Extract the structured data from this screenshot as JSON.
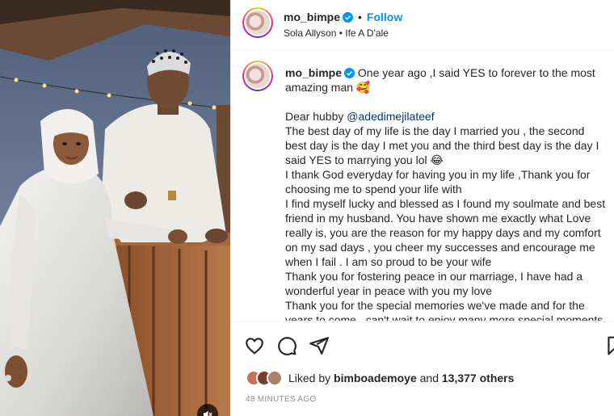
{
  "post": {
    "author": "mo_bimpe",
    "follow_label": "Follow",
    "separator": "•",
    "audio_line": "Sola Allyson • Ife A D'ale"
  },
  "caption": {
    "author": "mo_bimpe",
    "first_line": "One year ago ,I said YES to forever to the most amazing man 🥰",
    "greeting_prefix": "Dear hubby ",
    "mention": "@adedimejilateef",
    "lines": [
      "The best day of my life is the day I married you , the second best day is the day I met you and the third best day is the day I said YES to marrying you lol 😂",
      "I thank God everyday for having you in my life ,Thank you for choosing me to spend your life with",
      "I find myself lucky and blessed as I found my soulmate and best friend in my husband. You have shown me exactly what Love really is, you are the reason for my happy days and my comfort on my sad days , you cheer my successes and encourage me when I fail . I am so proud to be your wife",
      "Thank you for fostering peace in our marriage, I have had a wonderful year in peace with you my love",
      "Thank you for the special memories we've made and for the years to come , can't wait to enjoy many more special moments"
    ]
  },
  "engagement": {
    "liked_by_prefix": "Liked by ",
    "liked_by_user": "bimboademoye",
    "and": " and ",
    "others": "13,377 others",
    "timestamp": "48 MINUTES AGO"
  },
  "icons": {
    "like": "heart-icon",
    "comment": "comment-icon",
    "share": "share-icon",
    "save": "bookmark-icon",
    "mute": "speaker-muted-icon",
    "verified": "verified-badge-icon"
  },
  "colors": {
    "link": "#0095f6",
    "mention": "#00376b",
    "muted": "#8e8e8e",
    "text": "#262626"
  }
}
